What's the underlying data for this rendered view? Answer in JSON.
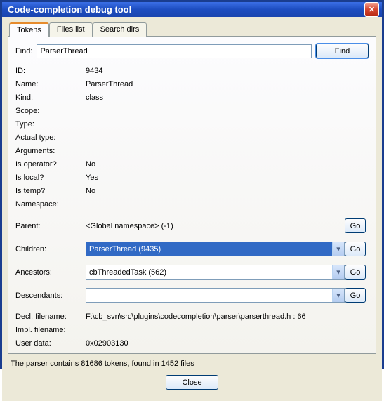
{
  "window": {
    "title": "Code-completion debug tool"
  },
  "tabs": {
    "t0": "Tokens",
    "t1": "Files list",
    "t2": "Search dirs"
  },
  "find": {
    "label": "Find:",
    "value": "ParserThread",
    "button": "Find"
  },
  "labels": {
    "id": "ID:",
    "name": "Name:",
    "kind": "Kind:",
    "scope": "Scope:",
    "type": "Type:",
    "actual": "Actual type:",
    "args": "Arguments:",
    "isop": "Is operator?",
    "islocal": "Is local?",
    "istemp": "Is temp?",
    "ns": "Namespace:",
    "parent": "Parent:",
    "children": "Children:",
    "ancestors": "Ancestors:",
    "desc": "Descendants:",
    "decl": "Decl. filename:",
    "impl": "Impl. filename:",
    "udata": "User data:"
  },
  "vals": {
    "id": "9434",
    "name": "ParserThread",
    "kind": "class",
    "scope": "",
    "type": "",
    "actual": "",
    "args": "",
    "isop": "No",
    "islocal": "Yes",
    "istemp": "No",
    "ns": "",
    "parent": "<Global namespace> (-1)",
    "children": "ParserThread (9435)",
    "ancestors": "cbThreadedTask (562)",
    "desc": "",
    "decl": "F:\\cb_svn\\src\\plugins\\codecompletion\\parser\\parserthread.h : 66",
    "impl": "",
    "udata": "0x02903130"
  },
  "go": "Go",
  "status": "The parser contains 81686 tokens, found in 1452 files",
  "close": "Close"
}
